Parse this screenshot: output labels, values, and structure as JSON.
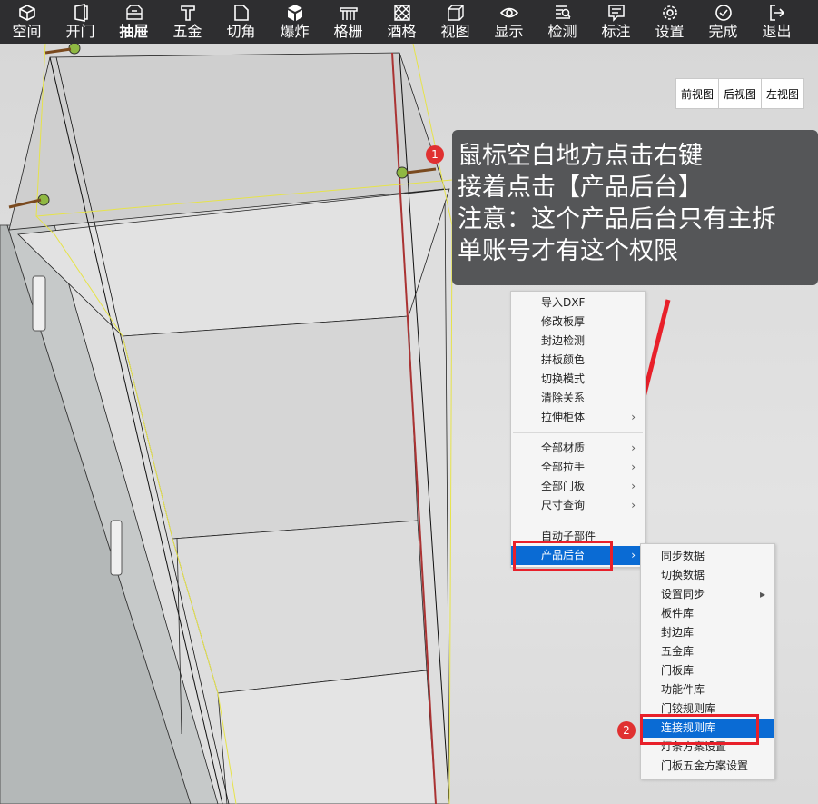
{
  "toolbar": {
    "items": [
      {
        "label": "空间",
        "icon": "cube-icon"
      },
      {
        "label": "开门",
        "icon": "door-icon"
      },
      {
        "label": "抽屉",
        "icon": "drawer-icon"
      },
      {
        "label": "五金",
        "icon": "hardware-icon"
      },
      {
        "label": "切角",
        "icon": "corner-cut-icon"
      },
      {
        "label": "爆炸",
        "icon": "explode-icon"
      },
      {
        "label": "格栅",
        "icon": "grille-icon"
      },
      {
        "label": "酒格",
        "icon": "wine-rack-icon"
      },
      {
        "label": "视图",
        "icon": "view-icon"
      },
      {
        "label": "显示",
        "icon": "eye-icon"
      },
      {
        "label": "检测",
        "icon": "detect-icon"
      },
      {
        "label": "标注",
        "icon": "annotate-icon"
      },
      {
        "label": "设置",
        "icon": "gear-icon"
      },
      {
        "label": "完成",
        "icon": "check-circle-icon"
      },
      {
        "label": "退出",
        "icon": "exit-icon"
      }
    ],
    "active_index": 2
  },
  "view_buttons": [
    "前视图",
    "后视图",
    "左视图"
  ],
  "tip": {
    "badge": "1",
    "lines": [
      "鼠标空白地方点击右键",
      "接着点击【产品后台】",
      "注意：这个产品后台只有主拆",
      "单账号才有这个权限"
    ]
  },
  "context_menu": {
    "group1": [
      "导入DXF",
      "修改板厚",
      "封边检测",
      "拼板颜色",
      "切换模式",
      "清除关系",
      "拉伸柜体"
    ],
    "group2": [
      "全部材质",
      "全部拉手",
      "全部门板",
      "尺寸查询"
    ],
    "group3": [
      "自动子部件",
      "产品后台"
    ]
  },
  "submenu": {
    "items": [
      "同步数据",
      "切换数据",
      "设置同步",
      "板件库",
      "封边库",
      "五金库",
      "门板库",
      "功能件库",
      "门铰规则库",
      "连接规则库",
      "灯条方案设置",
      "门板五金方案设置"
    ],
    "highlighted": "连接规则库"
  },
  "badge2": "2",
  "colors": {
    "toolbar_bg": "#2e2e30",
    "highlight": "#0a6bd4",
    "annotation_red": "#e8202a",
    "tip_bg": "#555658"
  }
}
